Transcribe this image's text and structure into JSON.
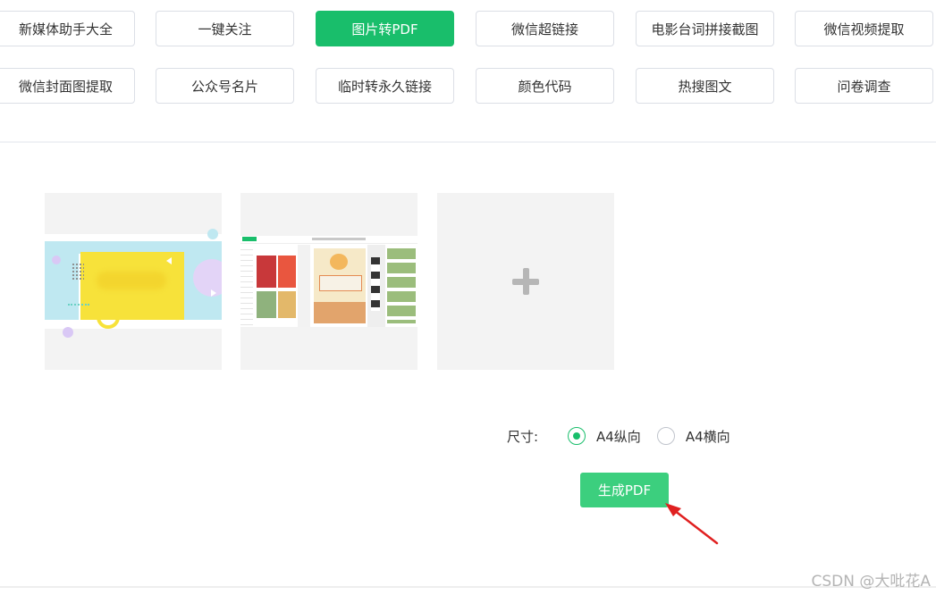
{
  "tools": {
    "row1": [
      {
        "label": "新媒体助手大全",
        "active": false
      },
      {
        "label": "一键关注",
        "active": false
      },
      {
        "label": "图片转PDF",
        "active": true
      },
      {
        "label": "微信超链接",
        "active": false
      },
      {
        "label": "电影台词拼接截图",
        "active": false
      },
      {
        "label": "微信视频提取",
        "active": false
      }
    ],
    "row2": [
      {
        "label": "微信封面图提取",
        "active": false
      },
      {
        "label": "公众号名片",
        "active": false
      },
      {
        "label": "临时转永久链接",
        "active": false
      },
      {
        "label": "颜色代码",
        "active": false
      },
      {
        "label": "热搜图文",
        "active": false
      },
      {
        "label": "问卷调查",
        "active": false
      }
    ]
  },
  "images": {
    "count": 2,
    "add_icon": "plus-icon"
  },
  "size_options": {
    "label": "尺寸:",
    "options": [
      {
        "label": "A4纵向",
        "checked": true
      },
      {
        "label": "A4横向",
        "checked": false
      }
    ]
  },
  "generate_button": {
    "label": "生成PDF"
  },
  "annotation": {
    "arrow_color": "#e02020"
  },
  "colors": {
    "accent": "#19be6b",
    "generate_bg": "#3ccf7e"
  },
  "watermark": "CSDN @大吡花A"
}
